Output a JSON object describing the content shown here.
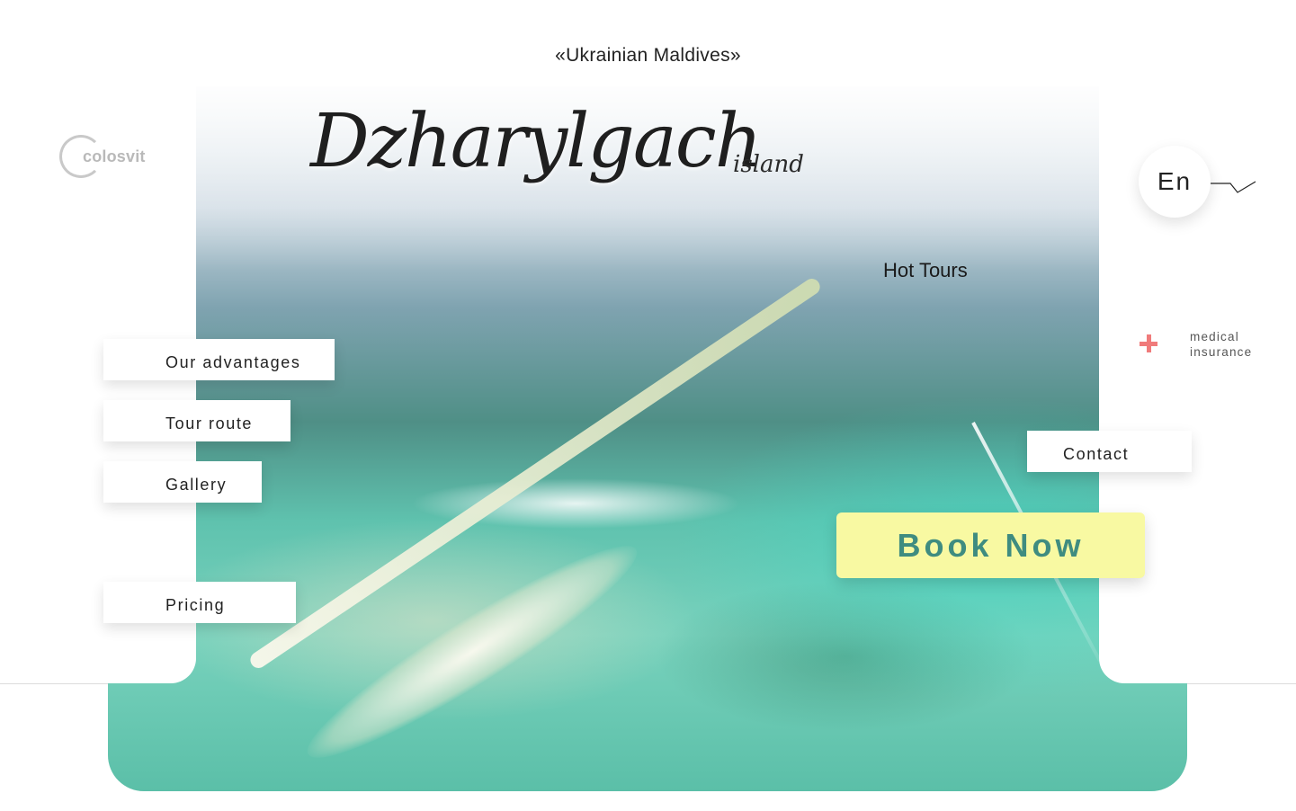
{
  "header": {
    "tagline": "«Ukrainian Maldives»"
  },
  "brand": {
    "logo_text": "colosvit"
  },
  "hero": {
    "title": "Dzharylgach",
    "subtitle": "island",
    "hot_tours": "Hot Tours"
  },
  "language": {
    "current": "En"
  },
  "insurance": {
    "line1": "medical",
    "line2": "insurance"
  },
  "nav": {
    "items": [
      {
        "label": "Our advantages"
      },
      {
        "label": "Tour route"
      },
      {
        "label": "Gallery"
      },
      {
        "label": "Pricing"
      }
    ],
    "contact": "Contact"
  },
  "cta": {
    "book_label": "Book Now"
  },
  "colors": {
    "accent_yellow": "#f8f9a2",
    "accent_teal": "#3f8c80",
    "insurance_red": "#f07b7b"
  }
}
